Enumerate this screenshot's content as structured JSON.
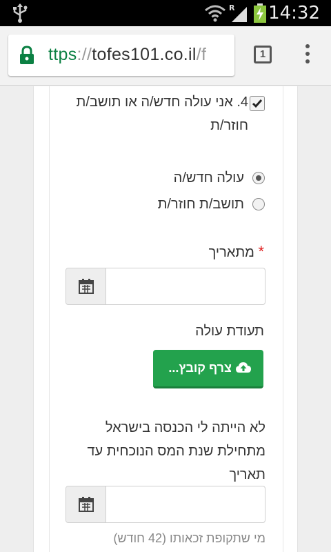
{
  "status_bar": {
    "time": "14:32",
    "network_label": "R",
    "icons": [
      "usb-icon",
      "wifi-icon",
      "signal-icon",
      "battery-charging-icon"
    ]
  },
  "browser": {
    "url_scheme": "ttps",
    "url_sep": "://",
    "url_host": "tofes101.co.il",
    "url_path": "/f",
    "tab_count": "1",
    "icons": [
      "lock-icon",
      "menu-icon"
    ]
  },
  "form": {
    "checkbox_label": "4. אני עולה חדש/ה או תושב/ת חוזר/ת",
    "checkbox_checked": true,
    "radio_options": [
      "עולה חדש/ה",
      "תושב/ת חוזר/ת"
    ],
    "radio_selected": 0,
    "from_date_label": "מתאריך",
    "required_mark": "*",
    "from_date_value": "",
    "certificate_label": "תעודת עולה",
    "upload_button_label": "צרף קובץ...",
    "no_income_text": "לא הייתה לי הכנסה בישראל מתחילת שנת המס הנוכחית עד תאריך",
    "no_income_date_value": "",
    "hint_text": "מי שתקופת זכאותו (42 חודש)"
  },
  "colors": {
    "accent_green": "#23a24d",
    "required_red": "#e02020",
    "secure_green": "#0b8043"
  }
}
